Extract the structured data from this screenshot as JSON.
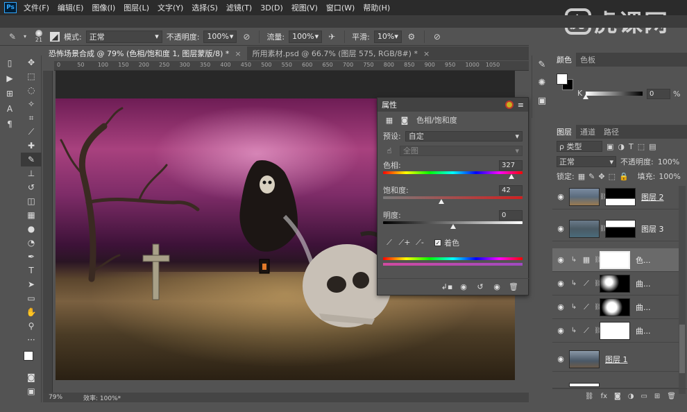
{
  "menu": {
    "app_logo": "Ps",
    "items": [
      "文件(F)",
      "编辑(E)",
      "图像(I)",
      "图层(L)",
      "文字(Y)",
      "选择(S)",
      "滤镜(T)",
      "3D(D)",
      "视图(V)",
      "窗口(W)",
      "帮助(H)"
    ]
  },
  "watermark": {
    "logo_char": "虎",
    "text": "虎课网"
  },
  "options": {
    "brush_size": "21",
    "mode_label": "模式:",
    "mode_value": "正常",
    "opacity_label": "不透明度:",
    "opacity_value": "100%",
    "flow_label": "流量:",
    "flow_value": "100%",
    "smooth_label": "平滑:",
    "smooth_value": "10%"
  },
  "tabs": [
    {
      "title": "恐怖场景合成 @ 79% (色相/饱和度 1, 图层蒙版/8) *",
      "close": "×"
    },
    {
      "title": "所用素材.psd @ 66.7% (图层 575, RGB/8#) *",
      "close": "×"
    }
  ],
  "ruler": [
    "0",
    "50",
    "100",
    "150",
    "200",
    "250",
    "300",
    "350",
    "400",
    "450",
    "500",
    "550",
    "600",
    "650",
    "700",
    "750",
    "800",
    "850",
    "900",
    "950",
    "1000",
    "1050"
  ],
  "status": {
    "zoom": "79%",
    "efficiency": "效率: 100%*"
  },
  "properties": {
    "title": "属性",
    "adjustment_name": "色相/饱和度",
    "preset_label": "预设:",
    "preset_value": "自定",
    "channel_value": "全图",
    "hue_label": "色相:",
    "hue_value": "327",
    "hue_pos": 0.92,
    "saturation_label": "饱和度:",
    "saturation_value": "42",
    "saturation_pos": 0.42,
    "lightness_label": "明度:",
    "lightness_value": "0",
    "lightness_pos": 0.5,
    "colorize_label": "着色"
  },
  "color_panel": {
    "tabs": [
      "颜色",
      "色板"
    ],
    "k_label": "K",
    "k_value": "0",
    "k_unit": "%"
  },
  "layers_panel": {
    "tabs": [
      "图层",
      "通道",
      "路径"
    ],
    "filter_label": "ρ 类型",
    "blend_mode": "正常",
    "opacity_label": "不透明度:",
    "opacity_value": "100%",
    "lock_label": "锁定:",
    "fill_label": "填充:",
    "fill_value": "100%",
    "layers": [
      {
        "name": "图层 2",
        "type": "image"
      },
      {
        "name": "图层 3",
        "type": "image"
      },
      {
        "name": "色...",
        "type": "hue"
      },
      {
        "name": "曲...",
        "type": "curves"
      },
      {
        "name": "曲...",
        "type": "curves"
      },
      {
        "name": "曲...",
        "type": "curves"
      },
      {
        "name": "图层 1",
        "type": "image"
      }
    ]
  }
}
